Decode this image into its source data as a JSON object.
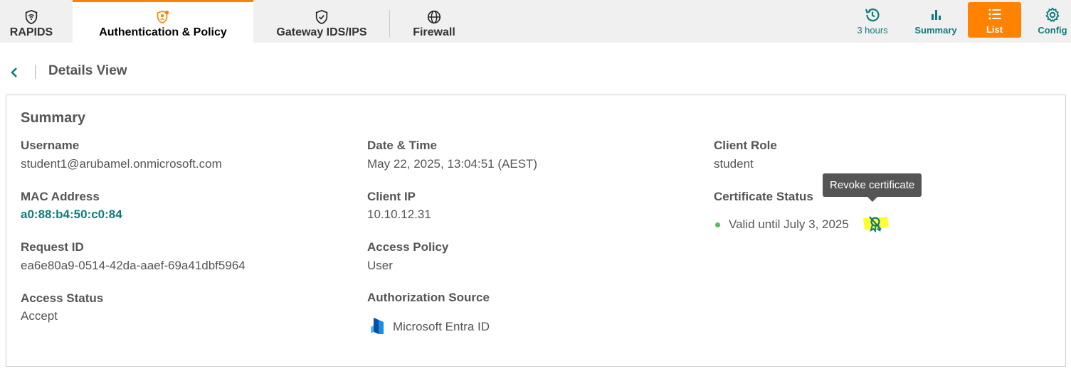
{
  "tabs": [
    {
      "label": "RAPIDS",
      "icon": "wifi-shield-icon",
      "active": false
    },
    {
      "label": "Authentication & Policy",
      "icon": "user-shield-icon",
      "active": true
    },
    {
      "label": "Gateway IDS/IPS",
      "icon": "check-shield-icon",
      "active": false
    },
    {
      "label": "Firewall",
      "icon": "globe-icon",
      "active": false
    }
  ],
  "toolbar": {
    "time_label": "3 hours",
    "summary_label": "Summary",
    "list_label": "List",
    "config_label": "Config"
  },
  "colors": {
    "accent": "#ff8300",
    "teal": "#0f7c7c",
    "status_green": "#5cb85c",
    "highlight": "#ffff33"
  },
  "details": {
    "title": "Details View",
    "summary_title": "Summary",
    "fields": {
      "username": {
        "label": "Username",
        "value": "student1@arubamel.onmicrosoft.com"
      },
      "mac": {
        "label": "MAC Address",
        "value": "a0:88:b4:50:c0:84"
      },
      "request_id": {
        "label": "Request ID",
        "value": "ea6e80a9-0514-42da-aaef-69a41dbf5964"
      },
      "access_status": {
        "label": "Access Status",
        "value": "Accept"
      },
      "datetime": {
        "label": "Date & Time",
        "value": "May 22, 2025, 13:04:51 (AEST)"
      },
      "client_ip": {
        "label": "Client IP",
        "value": "10.10.12.31"
      },
      "access_policy": {
        "label": "Access Policy",
        "value": "User"
      },
      "auth_source": {
        "label": "Authorization Source",
        "value": "Microsoft Entra ID"
      },
      "client_role": {
        "label": "Client Role",
        "value": "student"
      },
      "cert_status": {
        "label": "Certificate Status",
        "value": "Valid until July 3, 2025"
      }
    },
    "tooltip": "Revoke certificate"
  }
}
